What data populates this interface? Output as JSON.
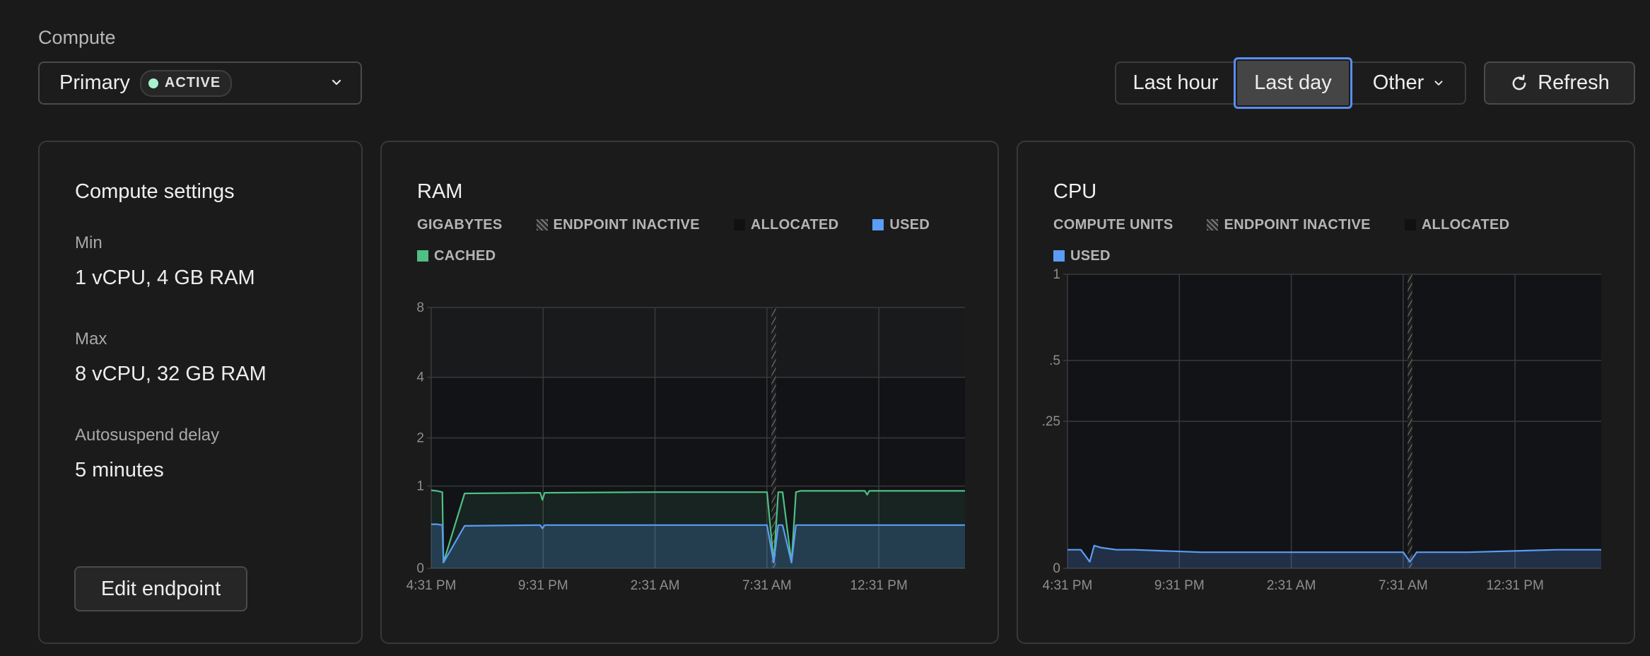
{
  "compute": {
    "section_label": "Compute",
    "selected_endpoint": "Primary",
    "status_badge": "ACTIVE",
    "status_color": "#a7f3d0"
  },
  "time_range": {
    "options": [
      "Last hour",
      "Last day",
      "Other"
    ],
    "selected": "Last day"
  },
  "refresh_label": "Refresh",
  "settings": {
    "title": "Compute settings",
    "min_label": "Min",
    "min_value": "1 vCPU, 4 GB RAM",
    "max_label": "Max",
    "max_value": "8 vCPU, 32 GB RAM",
    "autosuspend_label": "Autosuspend delay",
    "autosuspend_value": "5 minutes",
    "edit_button": "Edit endpoint"
  },
  "ram": {
    "title": "RAM",
    "legend": {
      "unit": "GIGABYTES",
      "inactive": "ENDPOINT INACTIVE",
      "allocated": "ALLOCATED",
      "used": "USED",
      "cached": "CACHED"
    }
  },
  "cpu": {
    "title": "CPU",
    "legend": {
      "unit": "COMPUTE UNITS",
      "inactive": "ENDPOINT INACTIVE",
      "allocated": "ALLOCATED",
      "used": "USED"
    }
  },
  "colors": {
    "used": "#5b9cf5",
    "cached": "#4fbf85",
    "allocated": "#111111",
    "accent": "#5b8def"
  },
  "chart_data": [
    {
      "type": "area",
      "title": "RAM",
      "ylabel": "GIGABYTES",
      "x_tick_labels": [
        "4:31 PM",
        "9:31 PM",
        "2:31 AM",
        "7:31 AM",
        "12:31 PM"
      ],
      "y_ticks": [
        0,
        1,
        2,
        4,
        8
      ],
      "y_tick_labels": [
        "0",
        "1",
        "2",
        "4",
        "8"
      ],
      "ylim": [
        0,
        8
      ],
      "y_scale": "symlog",
      "x": [
        0,
        0.25,
        0.5,
        0.55,
        1.5,
        4.9,
        5.0,
        5.1,
        10,
        14.9,
        15.1,
        15.4,
        15.6,
        15.8,
        16.2,
        16.4,
        16.6,
        18,
        19.5,
        19.6,
        19.7,
        24
      ],
      "series": [
        {
          "name": "ALLOCATED",
          "values": [
            4,
            4,
            4,
            4,
            4,
            4,
            4,
            4,
            4,
            4,
            4,
            4,
            4,
            4,
            4,
            4,
            4,
            4,
            4,
            4,
            4,
            4
          ]
        },
        {
          "name": "CACHED",
          "values": [
            0.93,
            0.92,
            0.9,
            0.05,
            0.88,
            0.89,
            0.78,
            0.89,
            0.9,
            0.9,
            0.9,
            0.05,
            0.9,
            0.9,
            0.05,
            0.9,
            0.92,
            0.92,
            0.92,
            0.86,
            0.92,
            0.92
          ]
        },
        {
          "name": "USED",
          "values": [
            0.45,
            0.45,
            0.44,
            0.05,
            0.43,
            0.44,
            0.4,
            0.44,
            0.44,
            0.44,
            0.44,
            0.05,
            0.44,
            0.44,
            0.05,
            0.44,
            0.44,
            0.44,
            0.44,
            0.44,
            0.44,
            0.44
          ]
        }
      ],
      "inactive_periods": [
        [
          15.3,
          15.5
        ]
      ],
      "grid": true
    },
    {
      "type": "line",
      "title": "CPU",
      "ylabel": "COMPUTE UNITS",
      "x_tick_labels": [
        "4:31 PM",
        "9:31 PM",
        "2:31 AM",
        "7:31 AM",
        "12:31 PM"
      ],
      "y_ticks": [
        0,
        0.25,
        0.5,
        1
      ],
      "y_tick_labels": [
        "0",
        ".25",
        ".5",
        "1"
      ],
      "ylim": [
        0,
        1
      ],
      "y_scale": "sqrt",
      "x": [
        0,
        0.6,
        1.0,
        1.2,
        1.5,
        2.2,
        3,
        6,
        10,
        14,
        15.1,
        15.4,
        15.7,
        18,
        22,
        24
      ],
      "series": [
        {
          "name": "ALLOCATED",
          "values": [
            1,
            1,
            1,
            1,
            1,
            1,
            1,
            1,
            1,
            1,
            1,
            1,
            1,
            1,
            1,
            1
          ]
        },
        {
          "name": "USED",
          "values": [
            0.004,
            0.004,
            0.0005,
            0.006,
            0.005,
            0.004,
            0.004,
            0.003,
            0.003,
            0.003,
            0.003,
            0.0005,
            0.003,
            0.003,
            0.004,
            0.004
          ]
        }
      ],
      "inactive_periods": [
        [
          15.3,
          15.5
        ]
      ],
      "grid": true
    }
  ]
}
